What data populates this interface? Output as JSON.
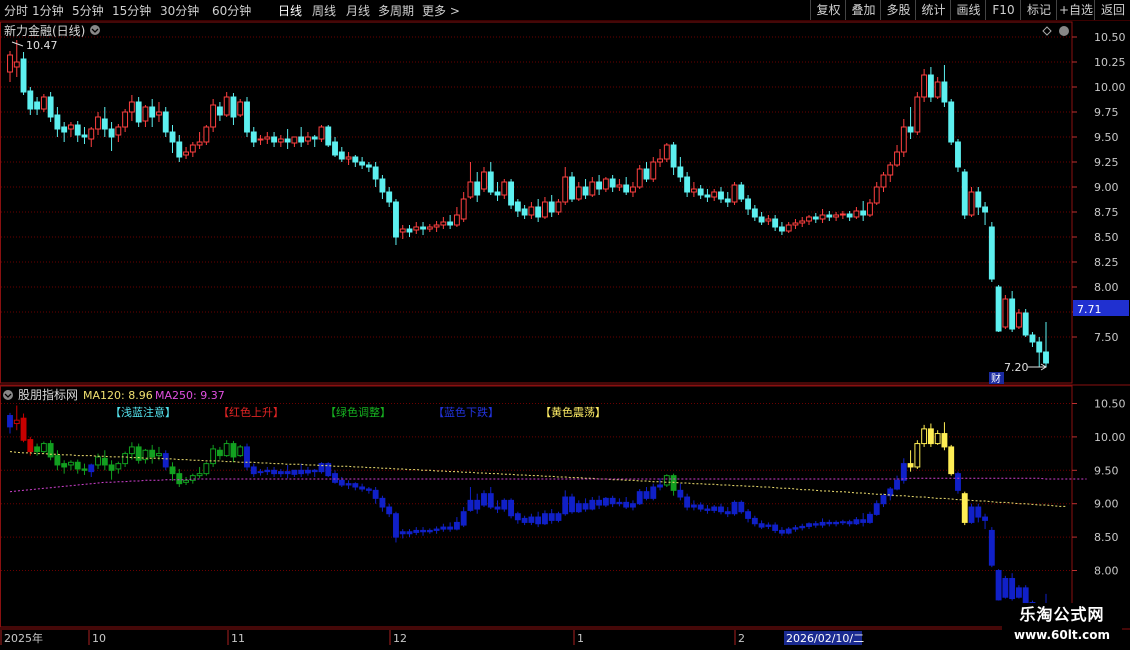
{
  "toolbar": {
    "periods": [
      "分时",
      "1分钟",
      "5分钟",
      "15分钟",
      "30分钟",
      "60分钟",
      "日线",
      "周线",
      "月线",
      "多周期",
      "更多 >"
    ],
    "active_index": 6,
    "right_buttons": [
      "复权",
      "叠加",
      "多股",
      "统计",
      "画线",
      "F10",
      "标记",
      "+自选",
      "返回"
    ]
  },
  "main_panel": {
    "title": "新力金融(日线)",
    "high_label": "10.47",
    "low_label": "7.20",
    "last_price": "7.71",
    "fin_tag": "财"
  },
  "indicator_panel": {
    "title": "股朋指标网",
    "ma120_label": "MA120: 8.96",
    "ma250_label": "MA250: 9.37",
    "legend": [
      {
        "text": "【浅蓝注意】",
        "color": "#55e3ee"
      },
      {
        "text": "【红色上升】",
        "color": "#e02424"
      },
      {
        "text": "【绿色调整】",
        "color": "#16b020"
      },
      {
        "text": "【蓝色下跌】",
        "color": "#2233dd"
      },
      {
        "text": "【黄色震荡】",
        "color": "#ffee66"
      }
    ]
  },
  "time_axis": {
    "labels": [
      "2025年",
      "10",
      "11",
      "12",
      "1",
      "2"
    ],
    "cursor_date": "2026/02/10/二"
  },
  "watermark": {
    "line1": "乐淘公式网",
    "line2": "www.60lt.com"
  },
  "colors": {
    "up": "#ff4040",
    "down": "#5df0f0",
    "grid": "#6a0000",
    "axis": "#8a1010",
    "ma120": "#f0e070",
    "ma250": "#d040d0",
    "red_cat": "#c80000",
    "green_cat": "#12a020",
    "blue_cat": "#1020c8",
    "yellow_cat": "#ffee55"
  },
  "chart_data": {
    "type": "candlestick",
    "price_axis_ticks": [
      "10.50",
      "10.25",
      "10.00",
      "9.75",
      "9.50",
      "9.25",
      "9.00",
      "8.75",
      "8.50",
      "8.25",
      "8.00",
      "7.75",
      "7.50"
    ],
    "indicator_axis_ticks": [
      "10.50",
      "10.00",
      "9.50",
      "9.00",
      "8.50",
      "8.00"
    ],
    "ylim": [
      7.2,
      10.55
    ],
    "ohlc": [
      [
        10.15,
        10.36,
        10.32,
        10.05
      ],
      [
        10.2,
        10.47,
        10.25,
        10.1
      ],
      [
        10.28,
        10.35,
        9.95,
        9.92
      ],
      [
        9.96,
        10.0,
        9.78,
        9.72
      ],
      [
        9.85,
        9.9,
        9.78,
        9.72
      ],
      [
        9.78,
        9.93,
        9.9,
        9.75
      ],
      [
        9.9,
        9.95,
        9.7,
        9.65
      ],
      [
        9.72,
        9.8,
        9.58,
        9.5
      ],
      [
        9.6,
        9.65,
        9.55,
        9.45
      ],
      [
        9.58,
        9.65,
        9.62,
        9.5
      ],
      [
        9.62,
        9.66,
        9.52,
        9.45
      ],
      [
        9.52,
        9.6,
        9.5,
        9.43
      ],
      [
        9.48,
        9.6,
        9.58,
        9.4
      ],
      [
        9.58,
        9.75,
        9.7,
        9.52
      ],
      [
        9.68,
        9.8,
        9.58,
        9.5
      ],
      [
        9.58,
        9.65,
        9.5,
        9.36
      ],
      [
        9.52,
        9.63,
        9.6,
        9.45
      ],
      [
        9.6,
        9.78,
        9.75,
        9.55
      ],
      [
        9.75,
        9.92,
        9.85,
        9.66
      ],
      [
        9.85,
        9.9,
        9.65,
        9.6
      ],
      [
        9.66,
        9.82,
        9.8,
        9.6
      ],
      [
        9.8,
        9.88,
        9.7,
        9.6
      ],
      [
        9.72,
        9.85,
        9.75,
        9.65
      ],
      [
        9.75,
        9.8,
        9.55,
        9.5
      ],
      [
        9.55,
        9.62,
        9.45,
        9.34
      ],
      [
        9.45,
        9.52,
        9.3,
        9.25
      ],
      [
        9.32,
        9.4,
        9.35,
        9.28
      ],
      [
        9.35,
        9.45,
        9.42,
        9.3
      ],
      [
        9.42,
        9.55,
        9.45,
        9.38
      ],
      [
        9.45,
        9.62,
        9.6,
        9.42
      ],
      [
        9.6,
        9.88,
        9.82,
        9.55
      ],
      [
        9.8,
        9.85,
        9.72,
        9.66
      ],
      [
        9.72,
        9.95,
        9.9,
        9.7
      ],
      [
        9.9,
        9.94,
        9.7,
        9.62
      ],
      [
        9.72,
        9.88,
        9.85,
        9.7
      ],
      [
        9.85,
        9.9,
        9.55,
        9.5
      ],
      [
        9.55,
        9.6,
        9.45,
        9.4
      ],
      [
        9.47,
        9.52,
        9.48,
        9.42
      ],
      [
        9.48,
        9.55,
        9.5,
        9.43
      ],
      [
        9.5,
        9.55,
        9.45,
        9.4
      ],
      [
        9.45,
        9.52,
        9.48,
        9.4
      ],
      [
        9.48,
        9.58,
        9.45,
        9.38
      ],
      [
        9.44,
        9.5,
        9.5,
        9.4
      ],
      [
        9.5,
        9.6,
        9.45,
        9.4
      ],
      [
        9.46,
        9.55,
        9.5,
        9.42
      ],
      [
        9.5,
        9.52,
        9.48,
        9.4
      ],
      [
        9.48,
        9.62,
        9.6,
        9.45
      ],
      [
        9.6,
        9.62,
        9.42,
        9.4
      ],
      [
        9.45,
        9.5,
        9.32,
        9.3
      ],
      [
        9.35,
        9.4,
        9.28,
        9.25
      ],
      [
        9.28,
        9.35,
        9.3,
        9.22
      ],
      [
        9.3,
        9.32,
        9.25,
        9.2
      ],
      [
        9.25,
        9.3,
        9.22,
        9.18
      ],
      [
        9.22,
        9.25,
        9.2,
        9.15
      ],
      [
        9.2,
        9.25,
        9.08,
        9.0
      ],
      [
        9.08,
        9.12,
        8.95,
        8.88
      ],
      [
        8.95,
        9.0,
        8.85,
        8.8
      ],
      [
        8.85,
        8.88,
        8.5,
        8.42
      ],
      [
        8.55,
        8.62,
        8.58,
        8.48
      ],
      [
        8.58,
        8.62,
        8.55,
        8.5
      ],
      [
        8.57,
        8.65,
        8.6,
        8.53
      ],
      [
        8.6,
        8.65,
        8.58,
        8.52
      ],
      [
        8.58,
        8.63,
        8.6,
        8.55
      ],
      [
        8.6,
        8.66,
        8.62,
        8.55
      ],
      [
        8.62,
        8.7,
        8.65,
        8.58
      ],
      [
        8.65,
        8.72,
        8.62,
        8.58
      ],
      [
        8.62,
        8.8,
        8.72,
        8.6
      ],
      [
        8.68,
        8.95,
        8.88,
        8.65
      ],
      [
        8.9,
        9.25,
        9.05,
        8.88
      ],
      [
        9.05,
        9.15,
        8.92,
        8.85
      ],
      [
        8.98,
        9.2,
        9.15,
        8.95
      ],
      [
        9.15,
        9.25,
        8.95,
        8.92
      ],
      [
        8.95,
        9.05,
        8.92,
        8.86
      ],
      [
        8.92,
        9.08,
        9.05,
        8.88
      ],
      [
        9.05,
        9.08,
        8.82,
        8.78
      ],
      [
        8.85,
        8.88,
        8.76,
        8.7
      ],
      [
        8.78,
        8.82,
        8.72,
        8.68
      ],
      [
        8.72,
        8.85,
        8.8,
        8.68
      ],
      [
        8.8,
        8.88,
        8.7,
        8.65
      ],
      [
        8.7,
        8.9,
        8.85,
        8.68
      ],
      [
        8.85,
        8.92,
        8.75,
        8.7
      ],
      [
        8.75,
        8.88,
        8.85,
        8.72
      ],
      [
        8.85,
        9.2,
        9.1,
        8.82
      ],
      [
        9.1,
        9.15,
        8.88,
        8.85
      ],
      [
        8.88,
        9.05,
        9.0,
        8.86
      ],
      [
        9.0,
        9.08,
        8.92,
        8.88
      ],
      [
        8.92,
        9.1,
        9.05,
        8.9
      ],
      [
        9.05,
        9.12,
        8.98,
        8.92
      ],
      [
        8.98,
        9.1,
        9.08,
        8.95
      ],
      [
        9.08,
        9.12,
        9.0,
        8.95
      ],
      [
        9.0,
        9.08,
        9.02,
        8.96
      ],
      [
        9.02,
        9.1,
        8.95,
        8.92
      ],
      [
        8.95,
        9.05,
        9.0,
        8.9
      ],
      [
        9.0,
        9.22,
        9.18,
        8.98
      ],
      [
        9.18,
        9.25,
        9.08,
        9.05
      ],
      [
        9.08,
        9.3,
        9.25,
        9.05
      ],
      [
        9.25,
        9.38,
        9.28,
        9.2
      ],
      [
        9.28,
        9.44,
        9.42,
        9.25
      ],
      [
        9.42,
        9.45,
        9.2,
        9.12
      ],
      [
        9.2,
        9.3,
        9.1,
        9.05
      ],
      [
        9.1,
        9.15,
        8.95,
        8.9
      ],
      [
        8.95,
        9.05,
        8.98,
        8.9
      ],
      [
        8.98,
        9.02,
        8.92,
        8.88
      ],
      [
        8.92,
        8.98,
        8.9,
        8.85
      ],
      [
        8.9,
        8.98,
        8.95,
        8.86
      ],
      [
        8.95,
        9.0,
        8.88,
        8.84
      ],
      [
        8.88,
        8.95,
        8.85,
        8.8
      ],
      [
        8.85,
        9.05,
        9.02,
        8.82
      ],
      [
        9.02,
        9.05,
        8.88,
        8.85
      ],
      [
        8.88,
        8.92,
        8.78,
        8.72
      ],
      [
        8.78,
        8.82,
        8.7,
        8.66
      ],
      [
        8.7,
        8.75,
        8.65,
        8.62
      ],
      [
        8.66,
        8.72,
        8.68,
        8.62
      ],
      [
        8.68,
        8.72,
        8.6,
        8.56
      ],
      [
        8.6,
        8.65,
        8.56,
        8.52
      ],
      [
        8.56,
        8.65,
        8.62,
        8.54
      ],
      [
        8.62,
        8.68,
        8.64,
        8.58
      ],
      [
        8.64,
        8.7,
        8.66,
        8.6
      ],
      [
        8.66,
        8.72,
        8.7,
        8.62
      ],
      [
        8.7,
        8.74,
        8.68,
        8.64
      ],
      [
        8.68,
        8.78,
        8.72,
        8.64
      ],
      [
        8.72,
        8.76,
        8.7,
        8.66
      ],
      [
        8.7,
        8.75,
        8.72,
        8.66
      ],
      [
        8.72,
        8.76,
        8.73,
        8.68
      ],
      [
        8.73,
        8.76,
        8.7,
        8.66
      ],
      [
        8.7,
        8.8,
        8.76,
        8.68
      ],
      [
        8.76,
        8.86,
        8.72,
        8.66
      ],
      [
        8.72,
        8.88,
        8.84,
        8.7
      ],
      [
        8.84,
        9.05,
        9.0,
        8.82
      ],
      [
        9.0,
        9.15,
        9.12,
        8.95
      ],
      [
        9.12,
        9.25,
        9.22,
        9.05
      ],
      [
        9.22,
        9.42,
        9.35,
        9.2
      ],
      [
        9.35,
        9.68,
        9.6,
        9.3
      ],
      [
        9.6,
        9.8,
        9.55,
        9.48
      ],
      [
        9.55,
        9.95,
        9.9,
        9.52
      ],
      [
        9.9,
        10.18,
        10.12,
        9.85
      ],
      [
        10.12,
        10.2,
        9.9,
        9.85
      ],
      [
        9.9,
        10.1,
        10.05,
        9.88
      ],
      [
        10.05,
        10.22,
        9.85,
        9.8
      ],
      [
        9.85,
        9.88,
        9.45,
        9.42
      ],
      [
        9.45,
        9.48,
        9.2,
        9.15
      ],
      [
        9.15,
        9.18,
        8.72,
        8.68
      ],
      [
        8.72,
        9.0,
        8.95,
        8.7
      ],
      [
        8.95,
        9.0,
        8.8,
        8.72
      ],
      [
        8.8,
        8.85,
        8.75,
        8.62
      ],
      [
        8.6,
        8.65,
        8.08,
        8.05
      ],
      [
        8.0,
        8.02,
        7.56,
        7.55
      ],
      [
        7.6,
        7.92,
        7.88,
        7.58
      ],
      [
        7.88,
        7.96,
        7.58,
        7.55
      ],
      [
        7.6,
        7.78,
        7.74,
        7.58
      ],
      [
        7.74,
        7.78,
        7.52,
        7.5
      ],
      [
        7.52,
        7.55,
        7.45,
        7.4
      ],
      [
        7.45,
        7.5,
        7.35,
        7.2
      ],
      [
        7.35,
        7.65,
        7.24,
        7.2
      ]
    ],
    "categories": [
      "blue",
      "red",
      "red",
      "red",
      "green",
      "green",
      "green",
      "green",
      "green",
      "green",
      "green",
      "green",
      "blue",
      "green",
      "green",
      "green",
      "green",
      "green",
      "green",
      "green",
      "green",
      "green",
      "green",
      "blue",
      "green",
      "green",
      "green",
      "green",
      "green",
      "green",
      "green",
      "green",
      "green",
      "green",
      "green",
      "blue",
      "blue",
      "blue",
      "blue",
      "blue",
      "blue",
      "blue",
      "blue",
      "blue",
      "blue",
      "blue",
      "blue",
      "blue",
      "blue",
      "blue",
      "blue",
      "blue",
      "blue",
      "blue",
      "blue",
      "blue",
      "blue",
      "blue",
      "blue",
      "blue",
      "blue",
      "blue",
      "blue",
      "blue",
      "blue",
      "blue",
      "blue",
      "blue",
      "blue",
      "blue",
      "blue",
      "blue",
      "blue",
      "blue",
      "blue",
      "blue",
      "blue",
      "blue",
      "blue",
      "blue",
      "blue",
      "blue",
      "blue",
      "blue",
      "blue",
      "blue",
      "blue",
      "blue",
      "blue",
      "blue",
      "blue",
      "blue",
      "blue",
      "blue",
      "blue",
      "blue",
      "blue",
      "green",
      "green",
      "blue",
      "blue",
      "blue",
      "blue",
      "blue",
      "blue",
      "blue",
      "blue",
      "blue",
      "blue",
      "blue",
      "blue",
      "blue",
      "blue",
      "blue",
      "blue",
      "blue",
      "blue",
      "blue",
      "blue",
      "blue",
      "blue",
      "blue",
      "blue",
      "blue",
      "blue",
      "blue",
      "blue",
      "blue",
      "blue",
      "blue",
      "blue",
      "blue",
      "blue",
      "yellow",
      "yellow",
      "yellow",
      "yellow",
      "yellow",
      "yellow",
      "yellow",
      "blue",
      "yellow",
      "blue",
      "blue",
      "blue",
      "blue",
      "blue",
      "blue",
      "blue",
      "blue",
      "blue",
      "blue",
      "blue",
      "blue",
      "blue",
      "blue",
      "blue",
      "blue",
      "blue",
      "blue"
    ],
    "ma120": [
      9.78,
      9.77,
      9.76,
      9.76,
      9.75,
      9.75,
      9.74,
      9.74,
      9.73,
      9.73,
      9.72,
      9.72,
      9.72,
      9.71,
      9.71,
      9.7,
      9.7,
      9.7,
      9.69,
      9.69,
      9.68,
      9.68,
      9.68,
      9.67,
      9.67,
      9.66,
      9.66,
      9.65,
      9.65,
      9.64,
      9.64,
      9.64,
      9.63,
      9.63,
      9.62,
      9.62,
      9.62,
      9.61,
      9.61,
      9.6,
      9.6,
      9.59,
      9.59,
      9.59,
      9.58,
      9.58,
      9.57,
      9.57,
      9.56,
      9.56,
      9.56,
      9.55,
      9.55,
      9.54,
      9.54,
      9.53,
      9.53,
      9.52,
      9.52,
      9.51,
      9.51,
      9.5,
      9.5,
      9.49,
      9.49,
      9.48,
      9.48,
      9.47,
      9.47,
      9.46,
      9.46,
      9.45,
      9.45,
      9.44,
      9.44,
      9.43,
      9.43,
      9.42,
      9.42,
      9.41,
      9.41,
      9.4,
      9.4,
      9.39,
      9.39,
      9.38,
      9.38,
      9.37,
      9.37,
      9.36,
      9.36,
      9.35,
      9.35,
      9.34,
      9.34,
      9.33,
      9.33,
      9.32,
      9.32,
      9.31,
      9.31,
      9.3,
      9.3,
      9.29,
      9.29,
      9.28,
      9.28,
      9.27,
      9.27,
      9.26,
      9.26,
      9.25,
      9.25,
      9.24,
      9.23,
      9.23,
      9.22,
      9.21,
      9.21,
      9.2,
      9.19,
      9.19,
      9.18,
      9.18,
      9.17,
      9.16,
      9.16,
      9.15,
      9.14,
      9.14,
      9.13,
      9.12,
      9.12,
      9.11,
      9.1,
      9.1,
      9.09,
      9.08,
      9.08,
      9.07,
      9.06,
      9.06,
      9.05,
      9.04,
      9.04,
      9.03,
      9.02,
      9.02,
      9.01,
      9.0,
      9.0,
      8.99,
      8.98,
      8.98,
      8.97,
      8.96,
      8.96
    ],
    "ma250": [
      9.18,
      9.19,
      9.2,
      9.21,
      9.22,
      9.23,
      9.24,
      9.25,
      9.26,
      9.27,
      9.28,
      9.29,
      9.3,
      9.31,
      9.32,
      9.32,
      9.33,
      9.33,
      9.34,
      9.34,
      9.35,
      9.35,
      9.35,
      9.36,
      9.36,
      9.36,
      9.36,
      9.37,
      9.37,
      9.37,
      9.37,
      9.37,
      9.37,
      9.37,
      9.37,
      9.37,
      9.37,
      9.37,
      9.37,
      9.37,
      9.37,
      9.37,
      9.37,
      9.37,
      9.37,
      9.37,
      9.37,
      9.37,
      9.37,
      9.37,
      9.37,
      9.37,
      9.37,
      9.37,
      9.37,
      9.37,
      9.37,
      9.37,
      9.37,
      9.37,
      9.37,
      9.37,
      9.37,
      9.37,
      9.37,
      9.37,
      9.37,
      9.37,
      9.37,
      9.37,
      9.37,
      9.37,
      9.37,
      9.37,
      9.37,
      9.37,
      9.37,
      9.37,
      9.37,
      9.37,
      9.37,
      9.37,
      9.37,
      9.37,
      9.37,
      9.37,
      9.37,
      9.37,
      9.37,
      9.37,
      9.37,
      9.37,
      9.37,
      9.37,
      9.37,
      9.37,
      9.37,
      9.37,
      9.37,
      9.37,
      9.37,
      9.37,
      9.37,
      9.37,
      9.37,
      9.37,
      9.37,
      9.37,
      9.37,
      9.37,
      9.37,
      9.37,
      9.37,
      9.37,
      9.37,
      9.37,
      9.37,
      9.37,
      9.37,
      9.37,
      9.37,
      9.37,
      9.37,
      9.37,
      9.37,
      9.37,
      9.37,
      9.37,
      9.37,
      9.37,
      9.37,
      9.37,
      9.37,
      9.38,
      9.38,
      9.38,
      9.38,
      9.38,
      9.38,
      9.38,
      9.38,
      9.38,
      9.38,
      9.38,
      9.38,
      9.38,
      9.38,
      9.38,
      9.38,
      9.38,
      9.38,
      9.38,
      9.38,
      9.37,
      9.37,
      9.37,
      9.37,
      9.37,
      9.37,
      9.37
    ]
  }
}
